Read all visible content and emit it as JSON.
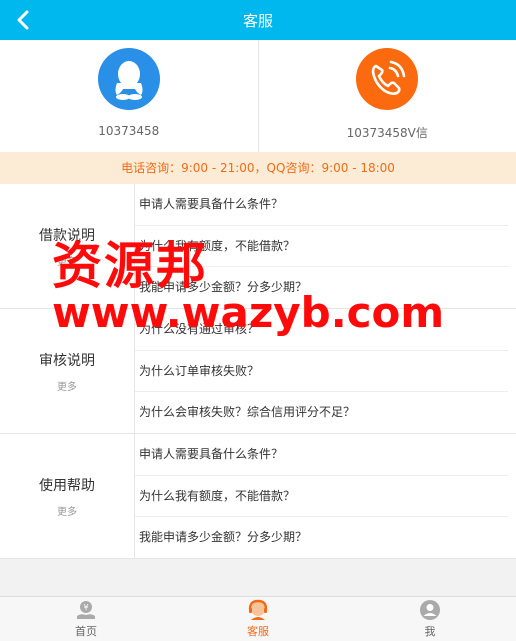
{
  "header": {
    "title": "客服"
  },
  "contacts": [
    {
      "icon": "qq-icon",
      "number": "10373458",
      "color": "#2a8fe6"
    },
    {
      "icon": "phone-icon",
      "number": "10373458V信",
      "color": "#fb6a0f"
    }
  ],
  "hours": "电话咨询：9:00 - 21:00，QQ咨询：9:00 - 18:00",
  "sections": [
    {
      "name": "借款说明",
      "more": "更多",
      "items": [
        "申请人需要具备什么条件？",
        "为什么我有额度，不能借款？",
        "我能申请多少金额？分多少期？"
      ]
    },
    {
      "name": "审核说明",
      "more": "更多",
      "items": [
        "为什么没有通过审核？",
        "为什么订单审核失败？",
        "为什么会审核失败？综合信用评分不足？"
      ]
    },
    {
      "name": "使用帮助",
      "more": "更多",
      "items": [
        "申请人需要具备什么条件？",
        "为什么我有额度，不能借款？",
        "我能申请多少金额？分多少期？"
      ]
    }
  ],
  "watermark": {
    "cn": "资源邦",
    "url": "www.wazyb.com"
  },
  "tabs": [
    {
      "label": "首页",
      "icon": "home-icon"
    },
    {
      "label": "客服",
      "icon": "service-icon",
      "active": true
    },
    {
      "label": "我",
      "icon": "user-icon"
    }
  ],
  "colors": {
    "header": "#00b7ee",
    "accent": "#f06b16",
    "watermark": "#ff0a0a"
  }
}
